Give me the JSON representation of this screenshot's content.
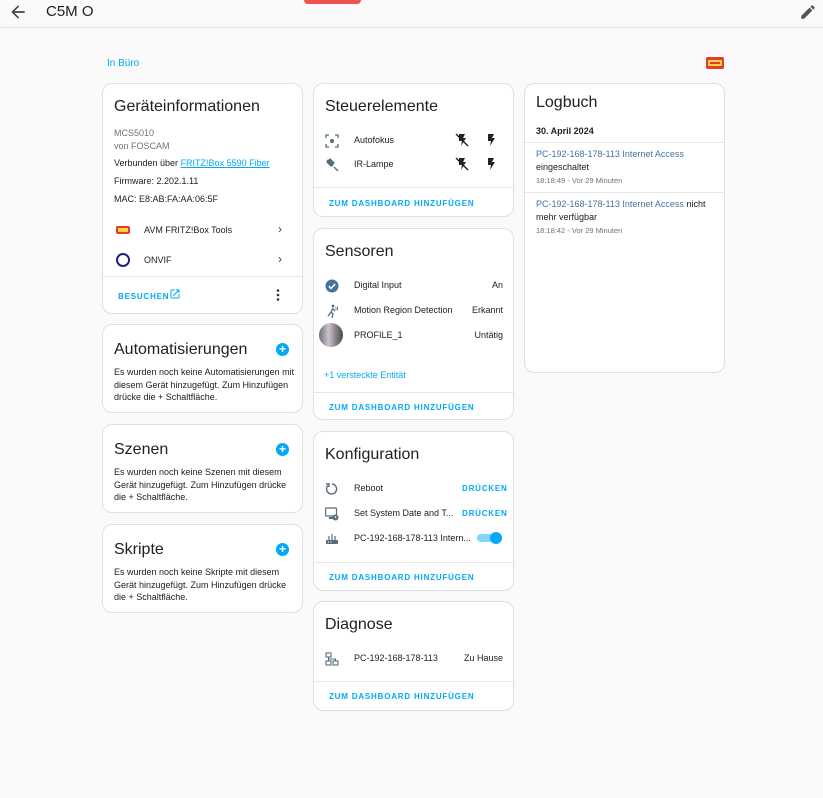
{
  "header": {
    "title": "C5M O",
    "back_icon": "arrow-left-icon",
    "edit_icon": "pencil-icon"
  },
  "breadcrumb": "In Büro",
  "device_info": {
    "title": "Geräteinformationen",
    "model": "MCS5010",
    "manufacturer": "von FOSCAM",
    "connected_prefix": "Verbunden über ",
    "connected_link": "FRITZ!Box 5590 Fiber",
    "firmware": "Firmware: 2.202.1.11",
    "mac": "MAC: E8:AB:FA:AA:06:5F",
    "integrations": [
      {
        "label": "AVM FRITZ!Box Tools",
        "icon": "fritz-logo-icon"
      },
      {
        "label": "ONVIF",
        "icon": "onvif-logo-icon"
      }
    ],
    "visit_label": "BESUCHEN"
  },
  "automations": {
    "title": "Automatisierungen",
    "text": "Es wurden noch keine Automatisierungen mit diesem Gerät hinzugefügt. Zum Hinzufügen drücke die + Schaltfläche."
  },
  "scenes": {
    "title": "Szenen",
    "text": "Es wurden noch keine Szenen mit diesem Gerät hinzugefügt. Zum Hinzufügen drücke die + Schaltfläche."
  },
  "scripts": {
    "title": "Skripte",
    "text": "Es wurden noch keine Skripte mit diesem Gerät hinzugefügt. Zum Hinzufügen drücke die + Schaltfläche."
  },
  "controls": {
    "title": "Steuerelemente",
    "items": [
      {
        "label": "Autofokus",
        "icon": "focus-icon"
      },
      {
        "label": "IR-Lampe",
        "icon": "spotlight-icon"
      }
    ],
    "action": "ZUM DASHBOARD HINZUFÜGEN"
  },
  "sensors": {
    "title": "Sensoren",
    "items": [
      {
        "label": "Digital Input",
        "value": "An",
        "icon": "check-circle-icon"
      },
      {
        "label": "Motion Region Detection",
        "value": "Erkannt",
        "icon": "motion-icon"
      },
      {
        "label": "PROFILE_1",
        "value": "Untätig",
        "icon": "camera-thumbnail-icon"
      }
    ],
    "hidden": "+1 versteckte Entität",
    "action": "ZUM DASHBOARD HINZUFÜGEN"
  },
  "config": {
    "title": "Konfiguration",
    "items": [
      {
        "label": "Reboot",
        "value": "DRÜCKEN",
        "icon": "restart-icon"
      },
      {
        "label": "Set System Date and T...",
        "value": "DRÜCKEN",
        "icon": "monitor-clock-icon"
      },
      {
        "label": "PC-192-168-178-113 Intern...",
        "icon": "router-icon",
        "toggle": true
      }
    ],
    "action": "ZUM DASHBOARD HINZUFÜGEN"
  },
  "diagnostics": {
    "title": "Diagnose",
    "items": [
      {
        "label": "PC-192-168-178-113",
        "value": "Zu Hause",
        "icon": "lan-icon"
      }
    ],
    "action": "ZUM DASHBOARD HINZUFÜGEN"
  },
  "logbook": {
    "title": "Logbuch",
    "date": "30. April 2024",
    "entries": [
      {
        "entity": "PC-192-168-178-113 Internet Access",
        "message": "eingeschaltet",
        "time": "18:18:49 - Vor 29 Minuten"
      },
      {
        "entity": "PC-192-168-178-113 Internet Access",
        "message": "nicht mehr verfügbar",
        "time": "18:18:42 - Vor 29 Minuten"
      }
    ]
  },
  "colors": {
    "accent": "#03a9f4",
    "toggle_track": "#81d4fa",
    "text": "#212121",
    "muted": "#727272"
  }
}
